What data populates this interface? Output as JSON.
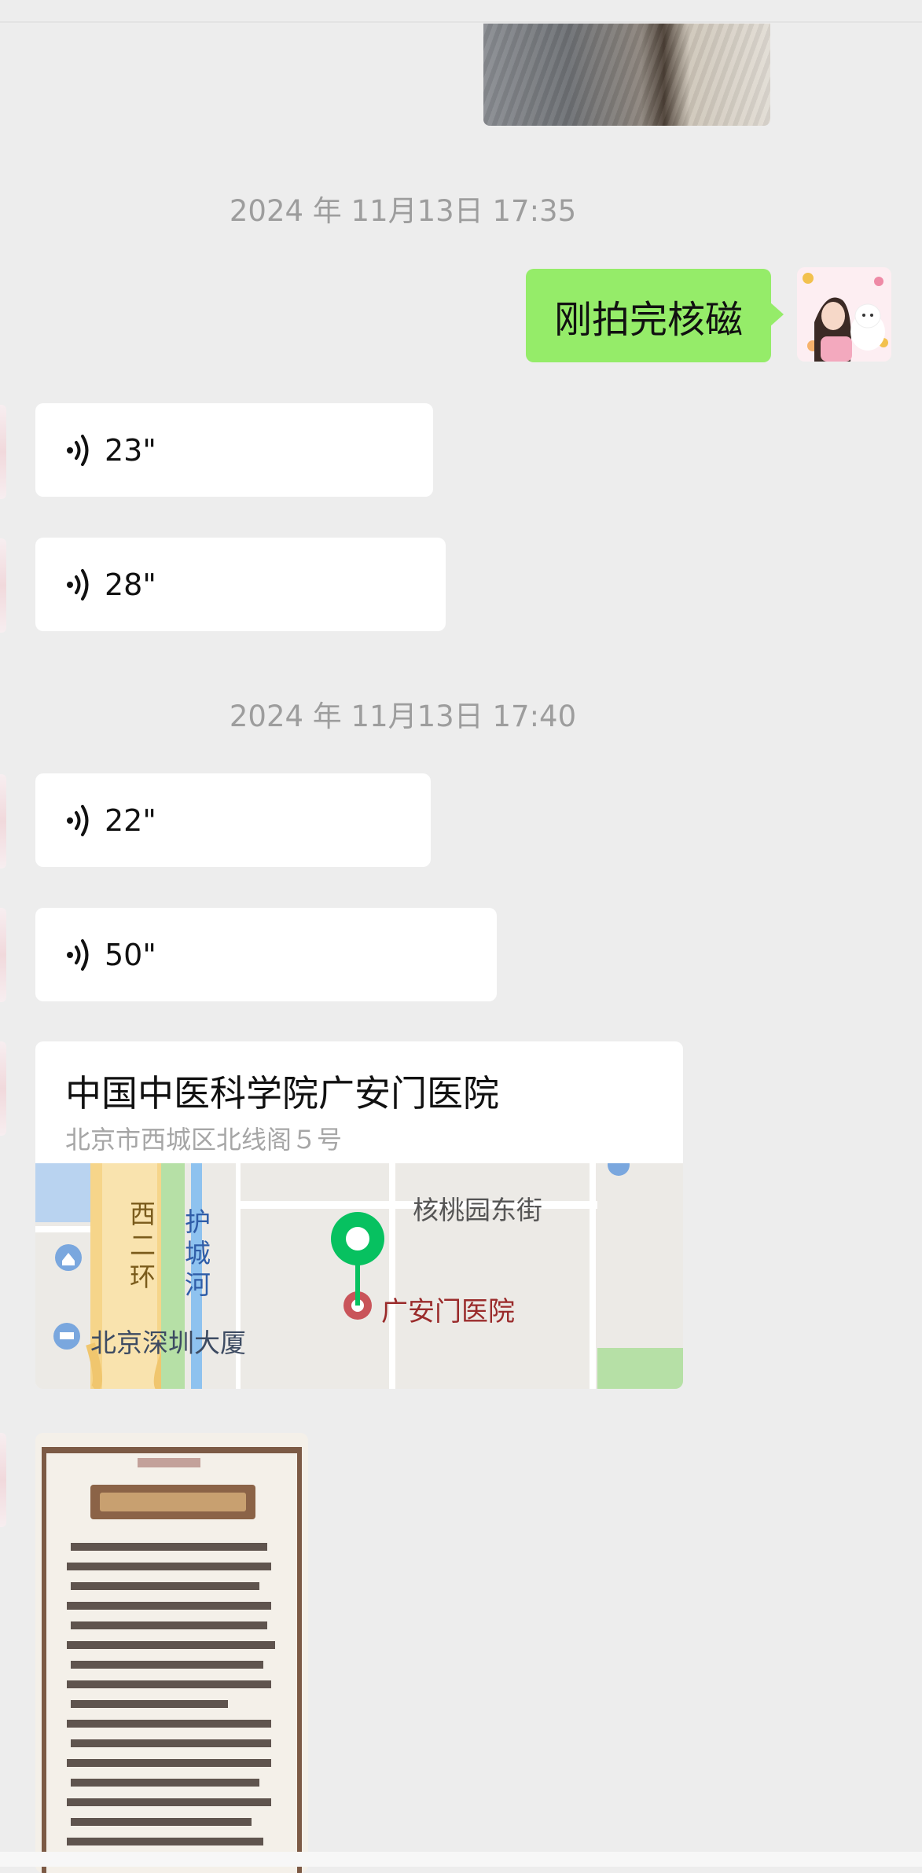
{
  "timestamps": [
    "2024 年 11月13日 17:35",
    "2024 年 11月13日 17:40"
  ],
  "outgoing": {
    "text": "刚拍完核磁"
  },
  "voice_messages": [
    {
      "duration": "23\""
    },
    {
      "duration": "28\""
    },
    {
      "duration": "22\""
    },
    {
      "duration": "50\""
    }
  ],
  "location": {
    "name": "中国中医科学院广安门医院",
    "address": "北京市西城区北线阁５号",
    "map_labels": {
      "street": "核桃园东街",
      "ring_road": [
        "西",
        "二",
        "环"
      ],
      "river": [
        "护",
        "城",
        "河"
      ],
      "building": "北京深圳大厦",
      "hospital": "广安门医院"
    }
  },
  "colors": {
    "bubble_out": "#95ec69",
    "pin": "#07c160",
    "hospital": "#9a2b2b"
  }
}
